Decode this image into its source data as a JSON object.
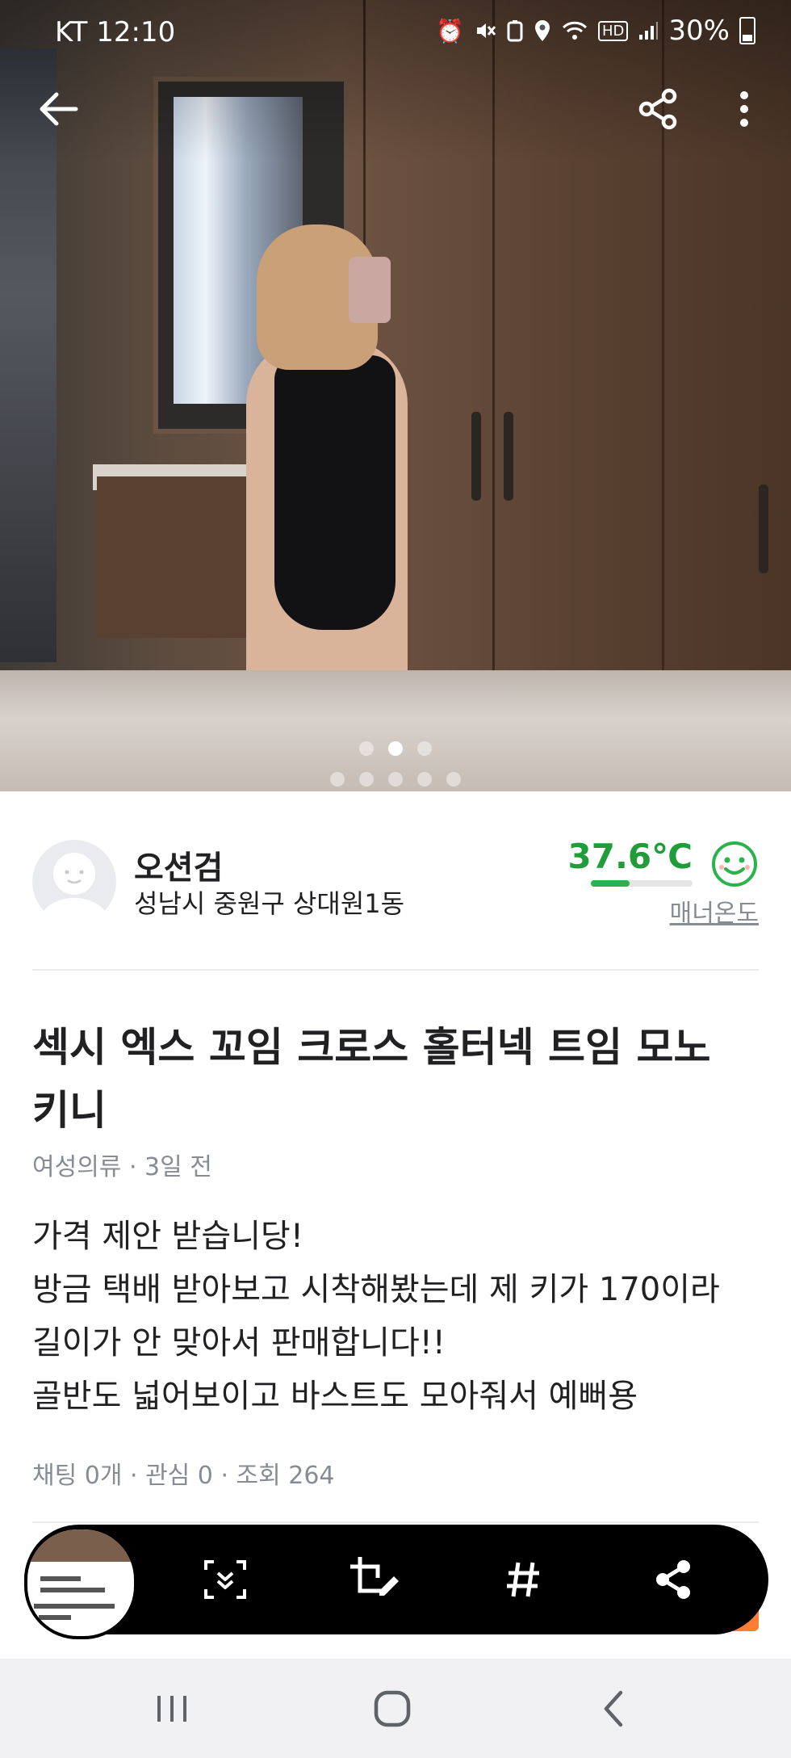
{
  "status_bar": {
    "carrier": "KT",
    "time": "12:10",
    "battery": "30%",
    "hd_label": "HD",
    "icons": [
      "alarm-icon",
      "mute-icon",
      "battery-saver-icon",
      "location-icon",
      "wifi-icon",
      "hd-voice-icon",
      "signal-icon",
      "battery-icon"
    ]
  },
  "app_bar": {
    "icons": [
      "back-arrow-icon",
      "share-icon",
      "more-vert-icon"
    ]
  },
  "gallery": {
    "image_count": 3,
    "active_index": 1
  },
  "seller": {
    "nickname": "오션검",
    "region": "성남시 중원구 상대원1동",
    "temperature": "37.6℃",
    "temperature_value": 37.6,
    "manner_label": "매너온도",
    "temperature_color": "#1f9d3a"
  },
  "article": {
    "title": "섹시 엑스 꼬임 크로스 홀터넥 트임 모노키니",
    "category": "여성의류",
    "time_ago": "3일 전",
    "description_lines": [
      "가격 제안 받습니당!",
      "방금 택배 받아보고 시착해봤는데 제 키가 170이라",
      "길이가 안 맞아서 판매합니다!!",
      "골반도 넓어보이고 바스트도 모아줘서 예뻐용"
    ],
    "stats": {
      "chats": "채팅 0개",
      "likes": "관심 0",
      "views": "조회 264"
    }
  },
  "capture_toolbar": {
    "tools": [
      "scroll-capture-icon",
      "crop-edit-icon",
      "hashtag-icon",
      "share-icon"
    ]
  },
  "nav_bar": {
    "buttons": [
      "recent-apps-icon",
      "home-icon",
      "back-icon"
    ]
  },
  "colors": {
    "accent_green": "#1f9d3a",
    "carrot_orange": "#ff7e36",
    "muted_text": "#868b94"
  }
}
